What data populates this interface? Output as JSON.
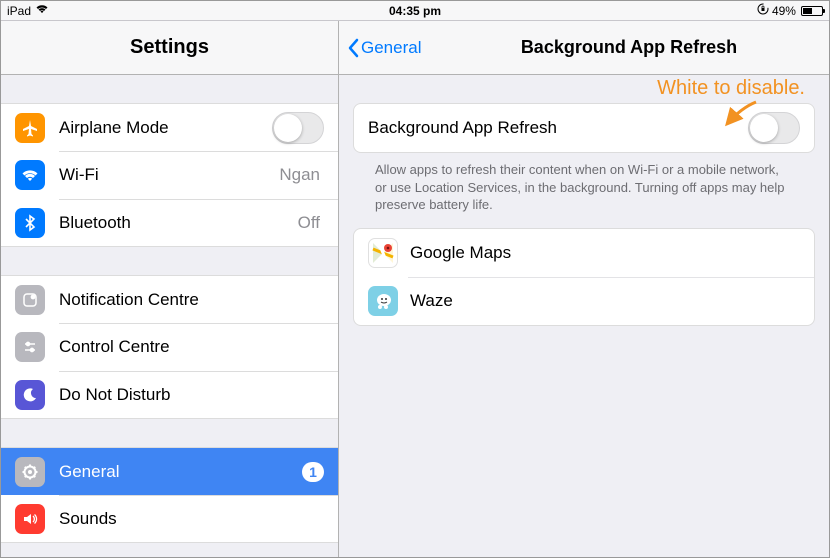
{
  "status": {
    "device": "iPad",
    "time": "04:35 pm",
    "battery_pct": "49%"
  },
  "sidebar": {
    "title": "Settings",
    "groups": [
      [
        {
          "label": "Airplane Mode",
          "icon": "airplane",
          "bg": "#ff9500",
          "value": "",
          "toggle": false
        },
        {
          "label": "Wi-Fi",
          "icon": "wifi",
          "bg": "#007aff",
          "value": "Ngan"
        },
        {
          "label": "Bluetooth",
          "icon": "bluetooth",
          "bg": "#007aff",
          "value": "Off"
        }
      ],
      [
        {
          "label": "Notification Centre",
          "icon": "notification",
          "bg": "#b8b8be"
        },
        {
          "label": "Control Centre",
          "icon": "control",
          "bg": "#b8b8be"
        },
        {
          "label": "Do Not Disturb",
          "icon": "moon",
          "bg": "#5856d6"
        }
      ],
      [
        {
          "label": "General",
          "icon": "gear",
          "bg": "#b8b8be",
          "selected": true,
          "badge": "1"
        },
        {
          "label": "Sounds",
          "icon": "speaker",
          "bg": "#ff3b30"
        }
      ]
    ]
  },
  "detail": {
    "back": "General",
    "title": "Background App Refresh",
    "master_label": "Background App Refresh",
    "description": "Allow apps to refresh their content when on Wi-Fi or a mobile network, or use Location Services, in the background. Turning off apps may help preserve battery life.",
    "apps": [
      {
        "label": "Google Maps",
        "icon": "gmaps"
      },
      {
        "label": "Waze",
        "icon": "waze"
      }
    ]
  },
  "annotation": {
    "text": "White to disable."
  }
}
